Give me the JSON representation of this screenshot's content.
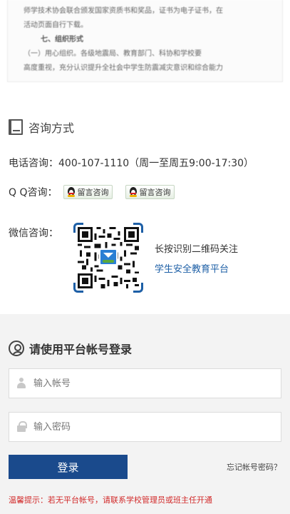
{
  "document_snippet": {
    "lines": [
      "师学技术协会联合颁发国家资质书和奖品，证书为电子证书，在",
      "活动页面自行下载。",
      "七、组织形式",
      "（一）用心组织。各级地震局、教育部门、科协和学校要",
      "高度重视，充分认识提升全社会中学生防震减灾意识和综合能力"
    ]
  },
  "contact": {
    "section_title": "咨询方式",
    "phone_line": "电话咨询：400-107-1110（周一至周五9:00-17:30）",
    "qq_label": "Q Q咨询：",
    "qq_buttons": [
      "留言咨询",
      "留言咨询"
    ],
    "wechat_label": "微信咨询：",
    "qr_tip": "长按识别二维码关注",
    "qr_account": "学生安全教育平台"
  },
  "login": {
    "title": "请使用平台帐号登录",
    "account_placeholder": "输入帐号",
    "password_placeholder": "输入密码",
    "submit_label": "登录",
    "forgot_label": "忘记帐号密码？",
    "tip": "温馨提示：若无平台帐号，请联系学校管理员或班主任开通"
  },
  "colors": {
    "primary": "#1a4a8c",
    "link_blue": "#1d5fa6",
    "warning_red": "#d22b2b"
  }
}
